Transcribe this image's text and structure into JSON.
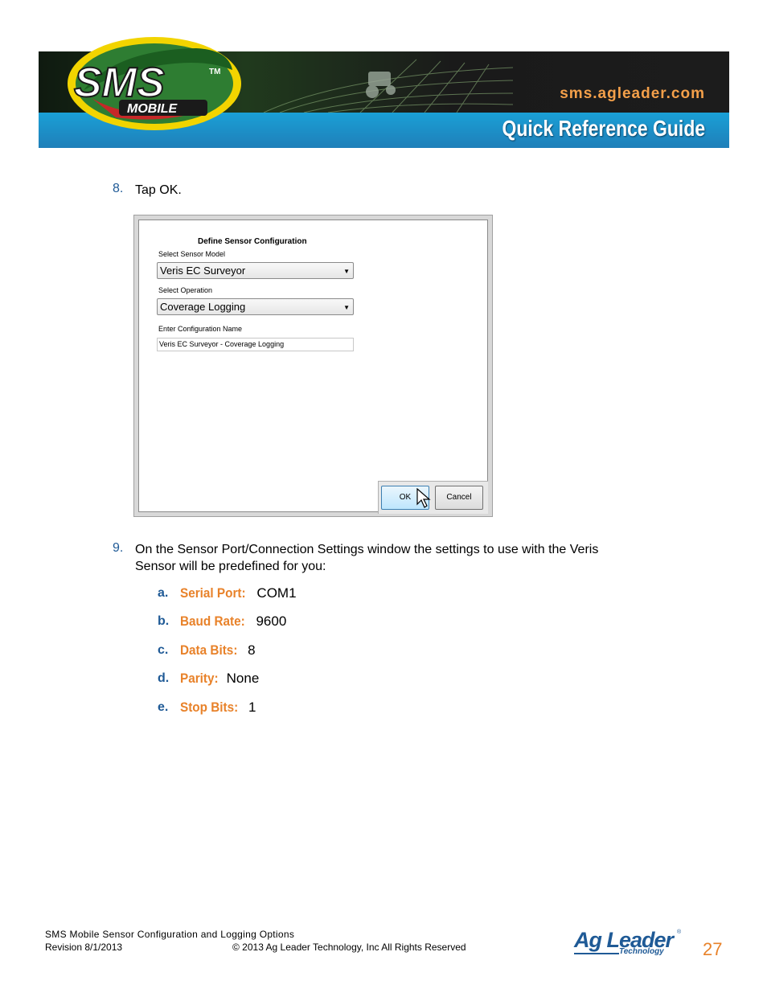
{
  "header": {
    "logo_main": "SMS",
    "logo_tm": "TM",
    "logo_sub": "MOBILE",
    "url": "sms.agleader.com",
    "guide_title": "Quick Reference Guide"
  },
  "step8": {
    "number": "8.",
    "prefix": "Tap ",
    "bold": "OK",
    "suffix": "."
  },
  "dialog": {
    "title": "Define Sensor Configuration",
    "sensor_model_label": "Select Sensor Model",
    "sensor_model_value": "Veris EC Surveyor",
    "operation_label": "Select Operation",
    "operation_value": "Coverage Logging",
    "config_name_label": "Enter Configuration Name",
    "config_name_value": "Veris EC Surveyor - Coverage Logging",
    "ok_label": "OK",
    "cancel_label": "Cancel"
  },
  "step9": {
    "number": "9.",
    "text_1": "On the ",
    "bold_1": "Sensor Port/Connection Settings",
    "text_2": " window the settings to use with the ",
    "bold_2a": "Veris",
    "bold_2b": "Sensor",
    "text_3": " will be predefined for you:",
    "items": [
      {
        "letter": "a.",
        "label": "Serial Port:",
        "value": " COM1"
      },
      {
        "letter": "b.",
        "label": "Baud Rate:",
        "value": " 9600"
      },
      {
        "letter": "c.",
        "label": "Data Bits:",
        "value": " 8"
      },
      {
        "letter": "d.",
        "label": "Parity:",
        "value": " None"
      },
      {
        "letter": "e.",
        "label": "Stop Bits:",
        "value": " 1"
      }
    ]
  },
  "footer": {
    "doc_title": "SMS Mobile Sensor Configuration and Logging Options",
    "revision": "Revision 8/1/2013",
    "copyright": "© 2013 Ag Leader Technology, Inc All Rights Reserved",
    "page_number": "27",
    "brand_main": "Ag Leader",
    "brand_sub": "Technology",
    "brand_reg": "®"
  },
  "colors": {
    "accent_orange": "#e8822a",
    "accent_blue": "#1f5a96",
    "banner_blue": "#1f7fb9"
  }
}
